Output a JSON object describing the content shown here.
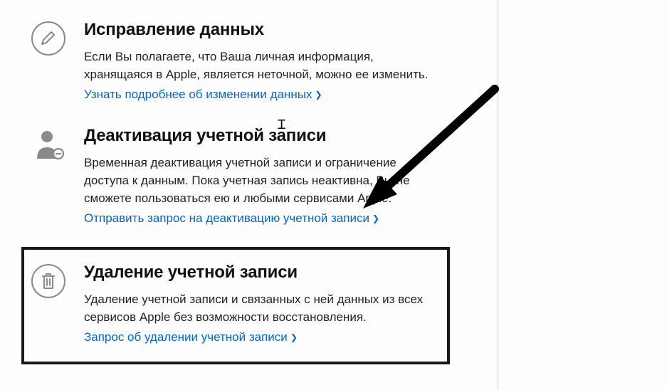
{
  "sections": {
    "correction": {
      "title": "Исправление данных",
      "desc": "Если Вы полагаете, что Ваша личная информация, хранящаяся в Apple, является неточной, можно ее изменить.",
      "link": "Узнать подробнее об изменении данных"
    },
    "deactivate": {
      "title": "Деактивация учетной записи",
      "desc": "Временная деактивация учетной записи и ограничение доступа к данным. Пока учетная запись неактивна, Вы не сможете пользоваться ею и любыми сервисами Apple.",
      "link": "Отправить запрос на деактивацию учетной записи"
    },
    "delete": {
      "title": "Удаление учетной записи",
      "desc": "Удаление учетной записи и связанных с ней данных из всех сервисов Apple без возможности восстановления.",
      "link": "Запрос об удалении учетной записи"
    }
  },
  "icons": {
    "correction": "pencil-icon",
    "deactivate": "person-minus-icon",
    "delete": "trash-icon"
  },
  "colors": {
    "link": "#0066cc",
    "text": "#222222",
    "iconStroke": "#8a8a8a"
  }
}
